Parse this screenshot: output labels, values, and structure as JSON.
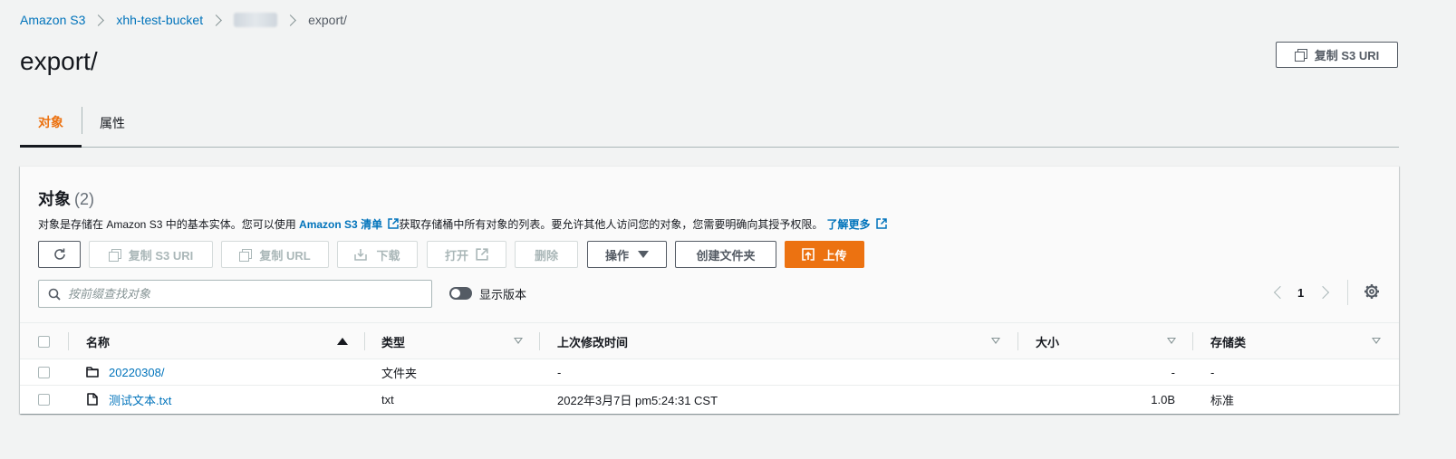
{
  "breadcrumb": {
    "items": [
      "Amazon S3",
      "xhh-test-bucket"
    ],
    "current": "export/"
  },
  "header": {
    "title": "export/",
    "copy_uri_label": "复制 S3 URI"
  },
  "tabs": [
    {
      "label": "对象",
      "active": true
    },
    {
      "label": "属性",
      "active": false
    }
  ],
  "objects_panel": {
    "title": "对象",
    "count": "(2)",
    "description_pre": "对象是存储在 Amazon S3 中的基本实体。您可以使用 ",
    "inventory_link": "Amazon S3 清单",
    "description_mid": "获取存储桶中所有对象的列表。要允许其他人访问您的对象，您需要明确向其授予权限。",
    "learn_more": "了解更多"
  },
  "toolbar": {
    "copy_s3_uri": "复制 S3 URI",
    "copy_url": "复制 URL",
    "download": "下载",
    "open": "打开",
    "delete": "删除",
    "actions": "操作",
    "create_folder": "创建文件夹",
    "upload": "上传"
  },
  "search": {
    "placeholder": "按前缀查找对象",
    "value": ""
  },
  "show_versions": {
    "label": "显示版本",
    "enabled": false
  },
  "pagination": {
    "current_page": "1"
  },
  "table": {
    "columns": [
      "名称",
      "类型",
      "上次修改时间",
      "大小",
      "存储类"
    ],
    "rows": [
      {
        "icon": "folder-icon",
        "name": "20220308/",
        "type": "文件夹",
        "modified": "-",
        "size": "-",
        "storage_class": "-"
      },
      {
        "icon": "file-icon",
        "name": "测试文本.txt",
        "type": "txt",
        "modified": "2022年3月7日 pm5:24:31 CST",
        "size": "1.0B",
        "storage_class": "标准"
      }
    ]
  },
  "colors": {
    "accent": "#ec7211",
    "link": "#0073bb",
    "text": "#16191f",
    "background": "#f2f3f3"
  }
}
